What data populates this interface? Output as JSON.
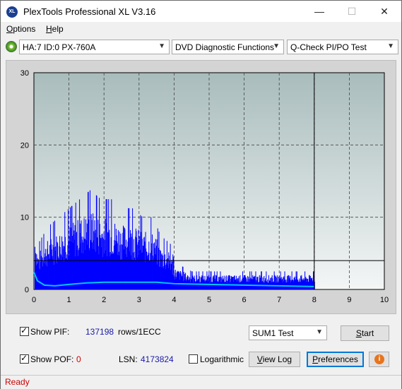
{
  "window": {
    "title": "PlexTools Professional XL V3.16",
    "app_icon_text": "XL",
    "minimize_glyph": "—",
    "maximize_glyph": "☐",
    "close_glyph": "✕"
  },
  "menu": {
    "options_accel": "O",
    "options_rest": "ptions",
    "help_accel": "H",
    "help_rest": "elp"
  },
  "toolbar": {
    "drive": "HA:7 ID:0  PX-760A",
    "function": "DVD Diagnostic Functions",
    "test": "Q-Check PI/PO Test",
    "dropdown_arrow": "▼"
  },
  "chart_data": {
    "type": "bar",
    "x_ticks": [
      "0",
      "1",
      "2",
      "3",
      "4",
      "5",
      "6",
      "7",
      "8",
      "9",
      "10"
    ],
    "y_ticks": [
      "0",
      "10",
      "20",
      "30"
    ],
    "xlim": [
      0,
      10
    ],
    "ylim": [
      0,
      30
    ],
    "grid": true,
    "series": [
      {
        "color": "#0000ff",
        "envelope_x": [
          0,
          0.1,
          0.4,
          0.7,
          1.0,
          1.3,
          1.6,
          1.9,
          2.2,
          2.5,
          2.8,
          3.1,
          3.4,
          3.6,
          3.9,
          4.0,
          4.5,
          5.0,
          5.5,
          6.0,
          6.5,
          7.0,
          7.5,
          7.9,
          8.0
        ],
        "envelope_y": [
          9,
          5,
          7,
          8,
          9,
          10,
          11,
          10,
          10,
          9,
          9,
          8,
          8,
          6,
          5,
          3,
          2,
          2,
          2,
          2,
          2,
          2,
          2,
          2,
          2
        ]
      },
      {
        "color": "#00c8ff",
        "x": [
          0,
          0.1,
          0.3,
          0.6,
          1.0,
          1.5,
          2.0,
          2.5,
          3.0,
          3.5,
          4.0,
          5.0,
          6.0,
          7.0,
          8.0
        ],
        "y": [
          2.4,
          1.2,
          0.6,
          0.5,
          0.7,
          0.9,
          1.0,
          1.0,
          1.0,
          1.0,
          0.8,
          0.7,
          0.6,
          0.5,
          0.4
        ]
      }
    ],
    "threshold_y": 4,
    "marker_x": 8
  },
  "bottom": {
    "show_pif_label": "Show PIF:",
    "pif_value": "137198",
    "pif_unit": "rows/1ECC",
    "show_pof_label": "Show POF:",
    "pof_value": "0",
    "lsn_label": "LSN:",
    "lsn_value": "4173824",
    "logarithmic_label": "Logarithmic",
    "sum_test": "SUM1 Test",
    "start_accel": "S",
    "start_rest": "tart",
    "view_log_accel": "V",
    "view_log_rest": "iew Log",
    "preferences_accel": "P",
    "preferences_rest": "references",
    "info_glyph": "i",
    "pif_color": "#1a1aa8",
    "pof_color": "#d40000"
  },
  "status": {
    "text": "Ready"
  }
}
